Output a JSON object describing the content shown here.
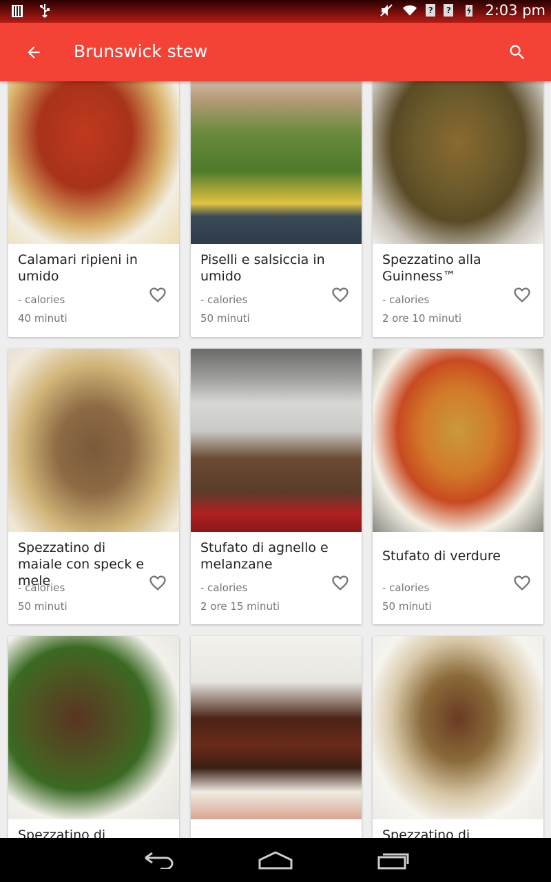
{
  "status_bar": {
    "time": "2:03 pm"
  },
  "app_bar": {
    "title": "Brunswick stew"
  },
  "recipes": [
    {
      "name": "Calamari ripieni in umido",
      "calories": "- calories",
      "time": "40 minuti"
    },
    {
      "name": "Piselli e salsiccia in umido",
      "calories": "- calories",
      "time": "50 minuti"
    },
    {
      "name": "Spezzatino alla Guinness™",
      "calories": "- calories",
      "time": "2 ore 10 minuti"
    },
    {
      "name": "Spezzatino di maiale con speck e mele",
      "calories": "- calories",
      "time": "50 minuti"
    },
    {
      "name": "Stufato di agnello e melanzane",
      "calories": "- calories",
      "time": "2 ore 15 minuti"
    },
    {
      "name": "Stufato di verdure",
      "calories": "- calories",
      "time": "50 minuti"
    },
    {
      "name": "Spezzatino di agnello",
      "calories": "",
      "time": ""
    },
    {
      "name": "",
      "calories": "",
      "time": ""
    },
    {
      "name": "Spezzatino di agnello",
      "calories": "",
      "time": ""
    }
  ],
  "colors": {
    "app_bar": "#f44336",
    "status_bar": "#b51b14"
  }
}
